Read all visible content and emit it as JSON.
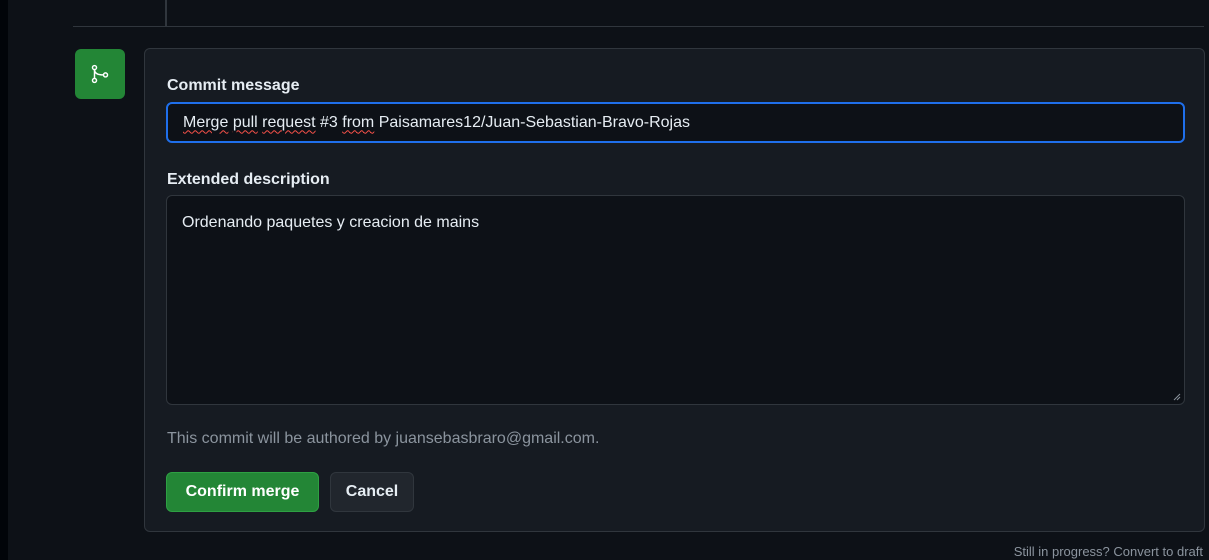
{
  "merge_form": {
    "commit_message_label": "Commit message",
    "commit_message_words": {
      "w1": "Merge",
      "w2": "pull",
      "w3": "request",
      "w4": "#3",
      "w5": "from",
      "w6": "Paisamares12/Juan-Sebastian-Bravo-Rojas"
    },
    "extended_description_label": "Extended description",
    "extended_description_value": "Ordenando paquetes y creacion de mains",
    "author_note": "This commit will be authored by juansebasbraro@gmail.com.",
    "confirm_label": "Confirm merge",
    "cancel_label": "Cancel"
  },
  "footer": {
    "draft_link": "Still in progress? Convert to draft"
  },
  "icons": {
    "badge": "git-merge-icon"
  },
  "colors": {
    "accent_green": "#238636",
    "focus_blue": "#1f6feb",
    "background": "#0d1117",
    "card": "#161b22"
  }
}
